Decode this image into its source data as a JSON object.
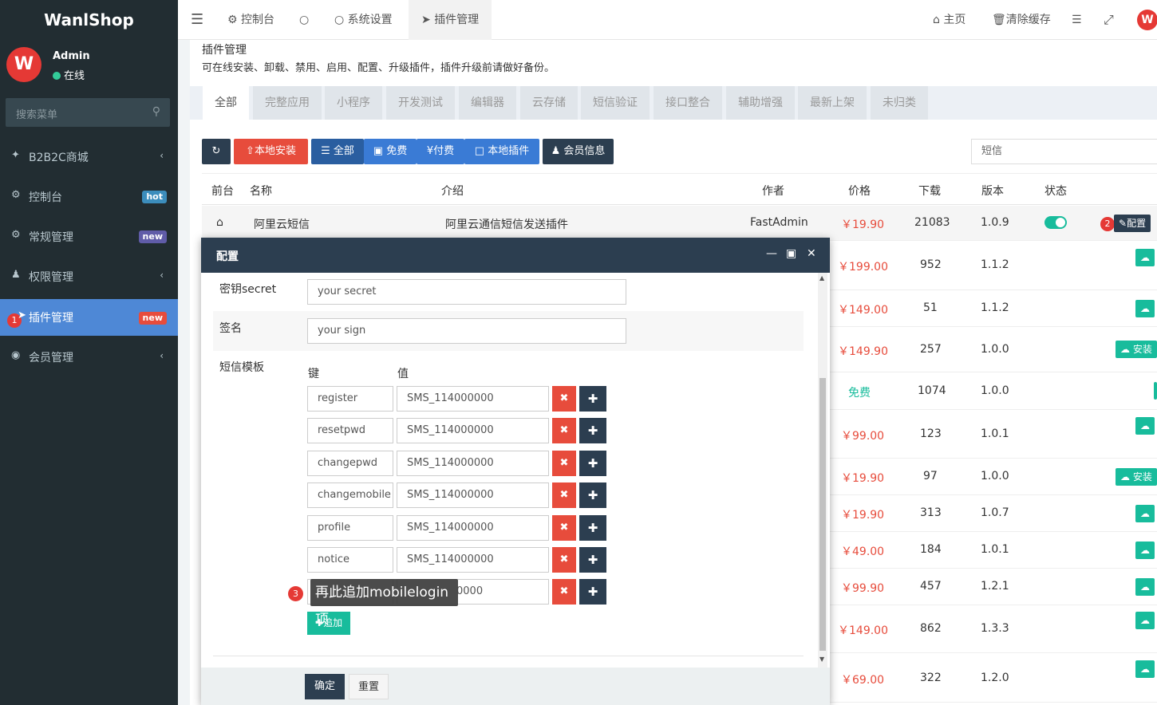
{
  "app": {
    "logo": "WanlShop",
    "avatar_letter": "W"
  },
  "user": {
    "name": "Admin",
    "status": "在线"
  },
  "sidebar": {
    "search_placeholder": "搜索菜单",
    "items": [
      {
        "label": "B2B2C商城",
        "icon": "magic-wand-icon",
        "badge": ""
      },
      {
        "label": "控制台",
        "icon": "dashboard-icon",
        "badge": "hot",
        "badge_color": "#3c8dbc"
      },
      {
        "label": "常规管理",
        "icon": "cogs-icon",
        "badge": "new",
        "badge_color": "#605ca8"
      },
      {
        "label": "权限管理",
        "icon": "group-icon",
        "badge": ""
      },
      {
        "label": "插件管理",
        "icon": "rocket-icon",
        "badge": "new",
        "badge_color": "#e74c3c",
        "marker": "1"
      },
      {
        "label": "会员管理",
        "icon": "user-circle-icon",
        "badge": ""
      }
    ]
  },
  "topbar": {
    "tabs": [
      {
        "label": "控制台",
        "icon": "dashboard-icon"
      },
      {
        "label": "",
        "icon": "circle-icon"
      },
      {
        "label": "系统设置",
        "icon": "circle-icon"
      },
      {
        "label": "插件管理",
        "icon": "rocket-icon"
      }
    ],
    "home": "主页",
    "clear_cache": "清除缓存"
  },
  "page": {
    "title": "插件管理",
    "description": "可在线安装、卸载、禁用、启用、配置、升级插件，插件升级前请做好备份。",
    "category_tabs": [
      "全部",
      "完整应用",
      "小程序",
      "开发测试",
      "编辑器",
      "云存储",
      "短信验证",
      "接口整合",
      "辅助增强",
      "最新上架",
      "未归类"
    ],
    "buttons": {
      "local_install": "本地安装",
      "all": "全部",
      "free": "免费",
      "paid": "付费",
      "local_plugins": "本地插件",
      "member_info": "会员信息"
    },
    "filter_value": "短信"
  },
  "table": {
    "headers": [
      "前台",
      "名称",
      "介绍",
      "作者",
      "价格",
      "下载",
      "版本",
      "状态"
    ],
    "first_row": {
      "name": "阿里云短信",
      "intro": "阿里云通信短信发送插件",
      "author": "FastAdmin",
      "price": "￥19.90",
      "downloads": "21083",
      "version": "1.0.9",
      "config_label": "配置",
      "marker": "2"
    },
    "rows": [
      {
        "price": "￥199.00",
        "downloads": "952",
        "version": "1.1.2"
      },
      {
        "price": "￥149.00",
        "downloads": "51",
        "version": "1.1.2"
      },
      {
        "price": "￥149.90",
        "downloads": "257",
        "version": "1.0.0",
        "install": "安装"
      },
      {
        "price": "免费",
        "downloads": "1074",
        "version": "1.0.0"
      },
      {
        "price": "￥99.00",
        "downloads": "123",
        "version": "1.0.1"
      },
      {
        "price": "￥19.90",
        "downloads": "97",
        "version": "1.0.0",
        "install": "安装"
      },
      {
        "price": "￥19.90",
        "downloads": "313",
        "version": "1.0.7"
      },
      {
        "price": "￥49.00",
        "downloads": "184",
        "version": "1.0.1"
      },
      {
        "price": "￥99.90",
        "downloads": "457",
        "version": "1.2.1"
      },
      {
        "price": "￥149.00",
        "downloads": "862",
        "version": "1.3.3"
      },
      {
        "price": "￥69.00",
        "downloads": "322",
        "version": "1.2.0"
      }
    ]
  },
  "modal": {
    "title": "配置",
    "secret_label": "密钥secret",
    "secret_value": "your secret",
    "sign_label": "签名",
    "sign_value": "your sign",
    "template_label": "短信模板",
    "key_header": "键",
    "value_header": "值",
    "templates": [
      {
        "key": "register",
        "value": "SMS_114000000"
      },
      {
        "key": "resetpwd",
        "value": "SMS_114000000"
      },
      {
        "key": "changepwd",
        "value": "SMS_114000000"
      },
      {
        "key": "changemobile",
        "value": "SMS_114000000"
      },
      {
        "key": "profile",
        "value": "SMS_114000000"
      },
      {
        "key": "notice",
        "value": "SMS_114000000"
      },
      {
        "key": "",
        "value": "0000"
      }
    ],
    "add_label": "追加",
    "confirm": "确定",
    "reset": "重置"
  },
  "annotation": {
    "marker": "3",
    "text": "再此追加mobilelogin项"
  }
}
